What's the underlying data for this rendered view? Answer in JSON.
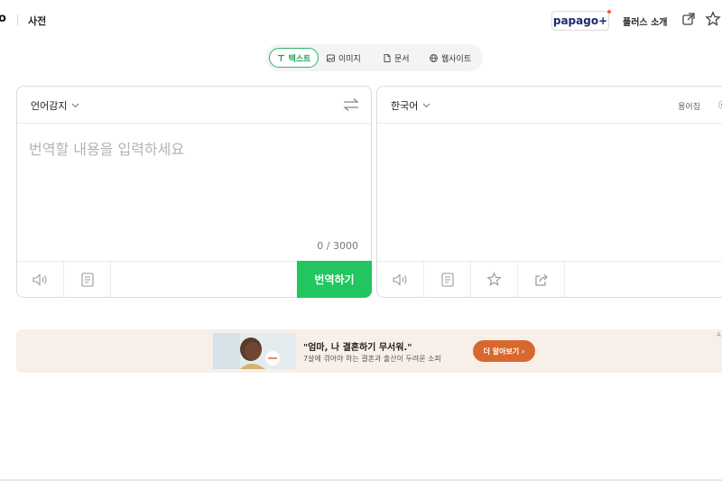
{
  "header": {
    "logo_fragment": "o",
    "dictionary_link": "사전",
    "papago_plus_label": "papago+",
    "plus_intro_label": "플러스 소개"
  },
  "tabs": [
    {
      "label": "텍스트",
      "icon": "text-icon",
      "active": true
    },
    {
      "label": "이미지",
      "icon": "image-icon",
      "active": false
    },
    {
      "label": "문서",
      "icon": "document-icon",
      "active": false
    },
    {
      "label": "웹사이트",
      "icon": "globe-icon",
      "active": false
    }
  ],
  "source": {
    "language": "언어감지",
    "placeholder": "번역할 내용을 입력하세요",
    "value": "",
    "char_count": "0 / 3000",
    "translate_button": "번역하기"
  },
  "target": {
    "language": "한국어",
    "glossary_label": "용어집",
    "glossary_enabled": false
  },
  "banner": {
    "title": "\"엄마, 나 결혼하기 무서워.\"",
    "subtitle": "7살에 겪어야 하는 결혼과 출산이 두려운 소피",
    "cta": "더 알아보기 ›",
    "ad_mark": "A"
  },
  "colors": {
    "accent_green": "#22c55e",
    "tab_active_border": "#2db36a",
    "banner_bg": "#f8efe9",
    "banner_cta": "#d8692e",
    "papago_navy": "#1d2b6b"
  }
}
